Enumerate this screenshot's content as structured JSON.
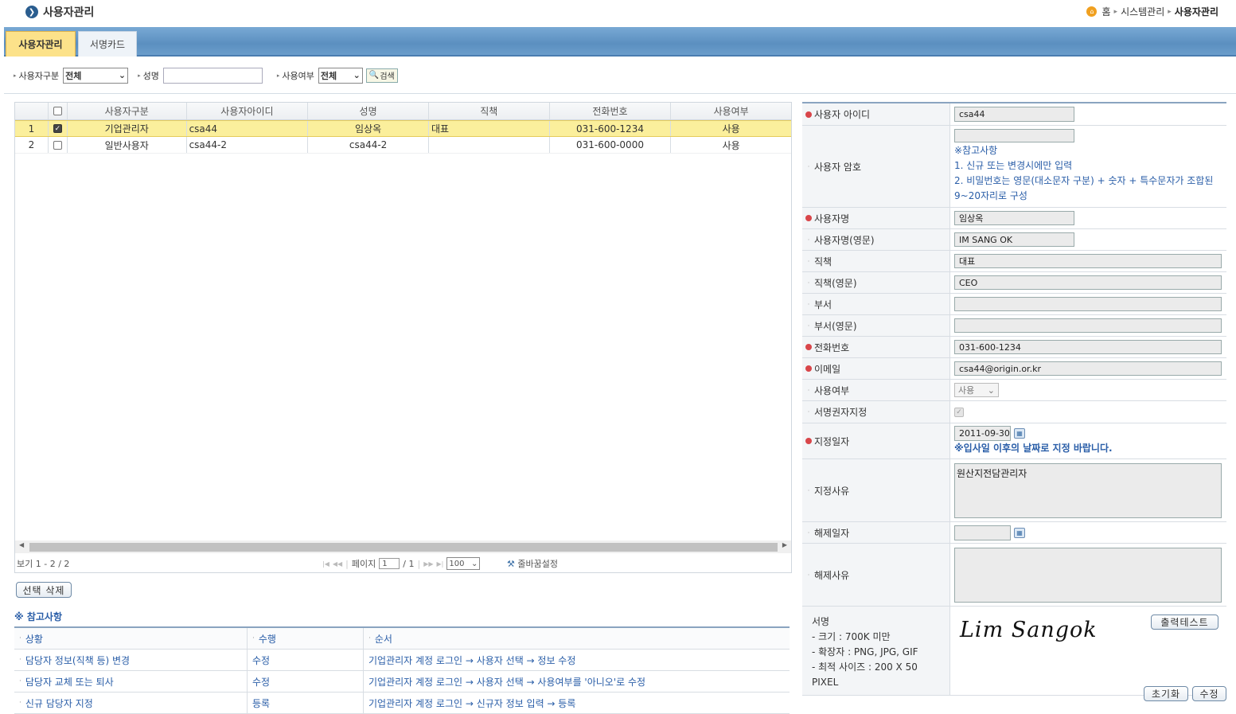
{
  "header": {
    "title": "사용자관리",
    "breadcrumb": [
      "홈",
      "시스템관리",
      "사용자관리"
    ]
  },
  "tabs": [
    {
      "label": "사용자관리",
      "active": true
    },
    {
      "label": "서명카드",
      "active": false
    }
  ],
  "search": {
    "type_label": "사용자구분",
    "type_value": "전체",
    "name_label": "성명",
    "name_value": "",
    "use_label": "사용여부",
    "use_value": "전체",
    "search_button": "검색"
  },
  "grid": {
    "columns": [
      "사용자구분",
      "사용자아이디",
      "성명",
      "직책",
      "전화번호",
      "사용여부"
    ],
    "rows": [
      {
        "num": "1",
        "checked": true,
        "type": "기업관리자",
        "id": "csa44",
        "name": "임상옥",
        "position": "대표",
        "phone": "031-600-1234",
        "use": "사용"
      },
      {
        "num": "2",
        "checked": false,
        "type": "일반사용자",
        "id": "csa44-2",
        "name": "csa44-2",
        "position": "",
        "phone": "031-600-0000",
        "use": "사용"
      }
    ],
    "footer": {
      "count_text": "보기 1 - 2 / 2",
      "page_label": "페이지",
      "page_value": "1",
      "page_total": "/ 1",
      "page_size": "100",
      "wrap_setting": "줄바꿈설정"
    }
  },
  "delete_button": "선택 삭제",
  "notes": {
    "title": "※ 참고사항",
    "headers": [
      "상황",
      "수행",
      "순서"
    ],
    "rows": [
      [
        "담당자 정보(직책 등) 변경",
        "수정",
        "기업관리자 계정 로그인 → 사용자 선택 → 정보 수정"
      ],
      [
        "담당자 교체 또는 퇴사",
        "수정",
        "기업관리자 계정 로그인 → 사용자 선택 → 사용여부를 '아니오'로 수정"
      ],
      [
        "신규 담당자 지정",
        "등록",
        "기업관리자 계정 로그인 → 신규자 정보 입력 → 등록"
      ]
    ]
  },
  "form": {
    "user_id_label": "사용자 아이디",
    "user_id": "csa44",
    "password_label": "사용자 암호",
    "password": "",
    "password_notes": [
      "※참고사항",
      "1. 신규 또는 변경시에만 입력",
      "2. 비밀번호는 영문(대소문자 구분) + 숫자 + 특수문자가 조합된 9~20자리로 구성"
    ],
    "name_label": "사용자명",
    "name": "임상옥",
    "name_en_label": "사용자명(영문)",
    "name_en": "IM SANG OK",
    "position_label": "직책",
    "position": "대표",
    "position_en_label": "직책(영문)",
    "position_en": "CEO",
    "dept_label": "부서",
    "dept": "",
    "dept_en_label": "부서(영문)",
    "dept_en": "",
    "phone_label": "전화번호",
    "phone": "031-600-1234",
    "email_label": "이메일",
    "email": "csa44@origin.or.kr",
    "use_label": "사용여부",
    "use": "사용",
    "sign_auth_label": "서명권자지정",
    "assign_date_label": "지정일자",
    "assign_date": "2011-09-30",
    "assign_date_note": "※입사일 이후의 날짜로 지정 바랍니다.",
    "assign_reason_label": "지정사유",
    "assign_reason": "원산지전담관리자",
    "release_date_label": "해제일자",
    "release_date": "",
    "release_reason_label": "해제사유",
    "release_reason": "",
    "signature_label": "서명",
    "signature_notes": [
      "- 크기 : 700K 미만",
      "- 확장자 : PNG, JPG, GIF",
      "- 최적 사이즈 : 200 X 50 PIXEL"
    ],
    "signature_text": "Lim Sangok",
    "print_test_button": "출력테스트"
  },
  "buttons": {
    "reset": "초기화",
    "update": "수정"
  }
}
